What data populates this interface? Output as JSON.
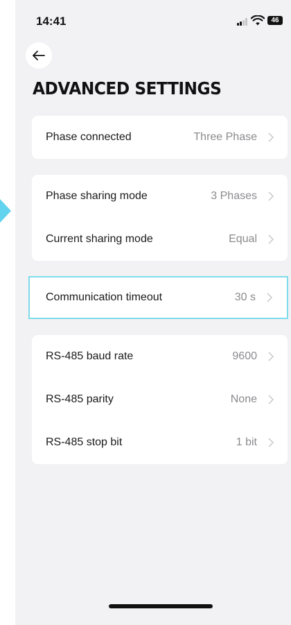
{
  "status_bar": {
    "time": "14:41",
    "battery": "46"
  },
  "header": {
    "title": "ADVANCED SETTINGS"
  },
  "groups": [
    {
      "rows": [
        {
          "label": "Phase connected",
          "value": "Three Phase"
        }
      ]
    },
    {
      "rows": [
        {
          "label": "Phase sharing mode",
          "value": "3 Phases"
        },
        {
          "label": "Current sharing mode",
          "value": "Equal"
        }
      ]
    },
    {
      "rows": [
        {
          "label": "Communication timeout",
          "value": "30 s"
        }
      ]
    },
    {
      "rows": [
        {
          "label": "RS-485 baud rate",
          "value": "9600"
        },
        {
          "label": "RS-485 parity",
          "value": "None"
        },
        {
          "label": "RS-485 stop bit",
          "value": "1 bit"
        }
      ]
    }
  ],
  "colors": {
    "background": "#f2f2f4",
    "card": "#ffffff",
    "value_text": "#8a8a8e",
    "highlight": "#7fdaea",
    "pointer": "#62d3ee"
  },
  "icons": {
    "back": "arrow-left-icon",
    "chevron": "chevron-right-icon",
    "signal": "cellular-signal-icon",
    "wifi": "wifi-icon",
    "battery": "battery-icon"
  }
}
